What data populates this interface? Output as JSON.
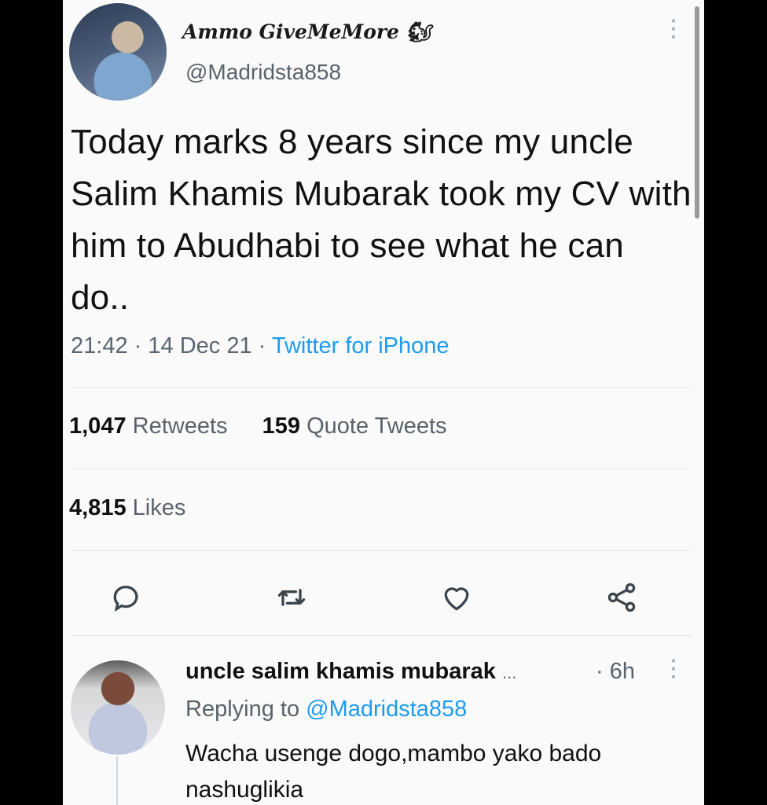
{
  "tweet": {
    "display_name": "Ammo GiveMeMore",
    "display_emoji": "🐿",
    "handle": "@Madridsta858",
    "text": "Today marks 8 years since my uncle Salim Khamis Mubarak took my CV with him to Abudhabi to see what he can do..",
    "time": "21:42",
    "date": "14 Dec 21",
    "source": "Twitter for iPhone",
    "separator": "·",
    "retweets_count": "1,047",
    "retweets_label": "Retweets",
    "quotes_count": "159",
    "quotes_label": "Quote Tweets",
    "likes_count": "4,815",
    "likes_label": "Likes",
    "menu_icon": "more-vertical-icon"
  },
  "actions": [
    {
      "name": "reply",
      "icon": "comment-icon"
    },
    {
      "name": "retweet",
      "icon": "retweet-icon"
    },
    {
      "name": "like",
      "icon": "heart-icon"
    },
    {
      "name": "share",
      "icon": "share-icon"
    }
  ],
  "reply": {
    "display_name": "uncle salim khamis mubarak",
    "ellipsis": "...",
    "separator": "·",
    "time": "6h",
    "replying_prefix": "Replying to",
    "replying_to": "@Madridsta858",
    "text": "Wacha usenge dogo,mambo yako bado nashuglikia"
  },
  "colors": {
    "accent": "#1d9bf0",
    "text": "#111111",
    "secondary": "#59626b",
    "background": "#fafafa"
  }
}
